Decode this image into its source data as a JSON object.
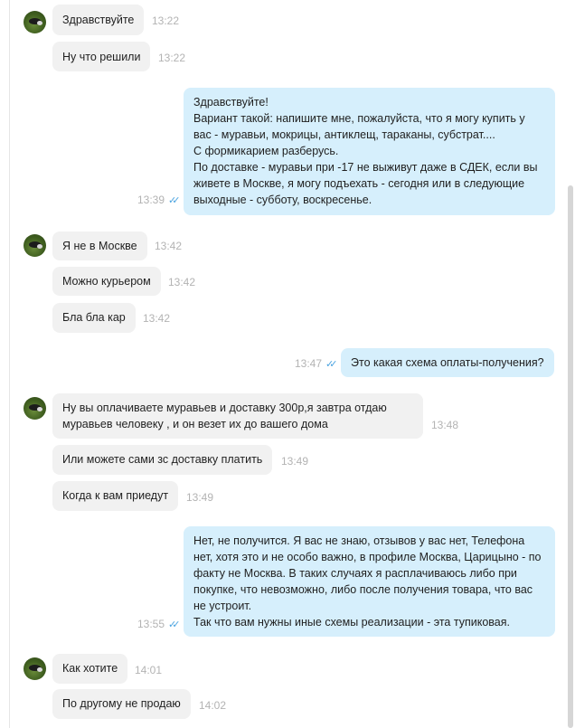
{
  "messages": [
    {
      "text": "Здравствуйте",
      "time": "13:22"
    },
    {
      "text": "Ну что решили",
      "time": "13:22"
    },
    {
      "text": "Здравствуйте!\nВариант такой: напишите мне, пожалуйста, что я могу купить у\nвас - муравьи, мокрицы, антиклещ, тараканы, субстрат....\nС формикарием разберусь.\nПо доставке - муравьи при -17 не выживут даже в СДЕК, если вы\nживете в Москве, я могу подъехать - сегодня или в следующие\nвыходные - субботу, воскресенье.",
      "time": "13:39"
    },
    {
      "text": "Я не в Москве",
      "time": "13:42"
    },
    {
      "text": "Можно курьером",
      "time": "13:42"
    },
    {
      "text": "Бла бла кар",
      "time": "13:42"
    },
    {
      "text": "Это какая схема оплаты-получения?",
      "time": "13:47"
    },
    {
      "text": "Ну вы оплачиваете муравьев и доставку 300р,я завтра отдаю\nмуравьев человеку , и он везет их до вашего дома",
      "time": "13:48"
    },
    {
      "text": "Или можете сами зс доставку платить",
      "time": "13:49"
    },
    {
      "text": "Когда к вам приедут",
      "time": "13:49"
    },
    {
      "text": "Нет, не получится. Я вас не знаю, отзывов у вас нет, Телефона\nнет, хотя это и не особо важно, в профиле Москва, Царицыно - по\nфакту не Москва. В таких случаях я расплачиваюсь либо при\nпокупке, что невозможно, либо после получения товара, что вас\nне устроит.\nТак что вам нужны иные схемы реализации - эта тупиковая.",
      "time": "13:55"
    },
    {
      "text": "Как хотите",
      "time": "14:01"
    },
    {
      "text": "По другому не продаю",
      "time": "14:02"
    }
  ],
  "colors": {
    "incoming_bubble": "#f1f1f1",
    "outgoing_bubble": "#d6effc",
    "read_check": "#4aa3e0",
    "timestamp": "#b3b3b3"
  },
  "icons": {
    "avatar": "ant-avatar",
    "read_status": "double-check-icon",
    "read_status_glyph": "✓✓"
  }
}
